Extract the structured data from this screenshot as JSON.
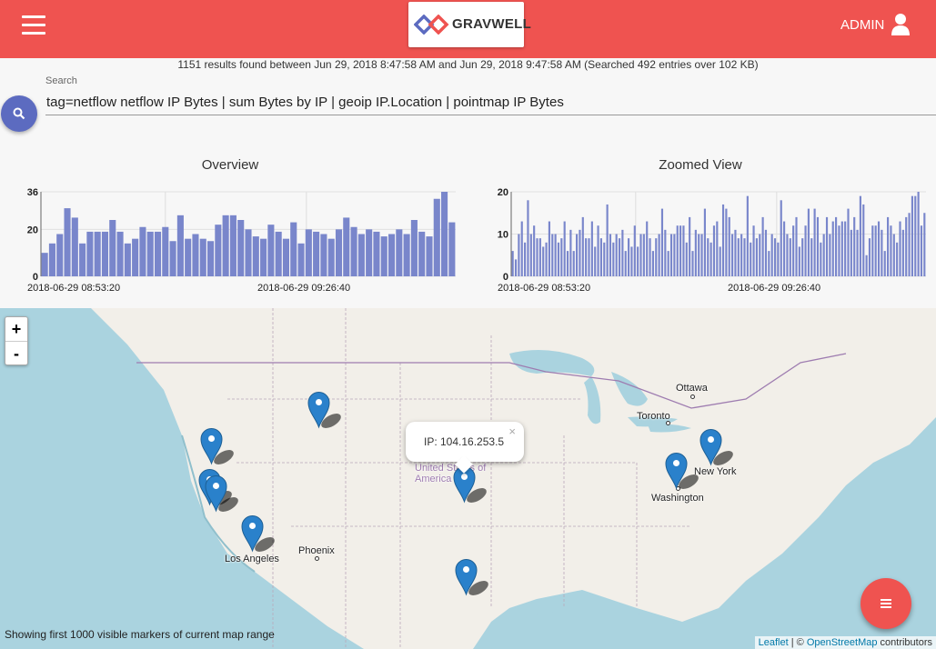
{
  "header": {
    "menu_icon": "hamburger-menu-icon",
    "logo_text": "GRAVWELL",
    "user_label": "ADMIN",
    "user_icon": "user-icon",
    "bar_color": "#ef5350"
  },
  "status": {
    "summary": "1151 results found between Jun 29, 2018 8:47:58 AM and Jun 29, 2018 9:47:58 AM (Searched 492 entries over 102 KB)"
  },
  "search": {
    "label": "Search",
    "query": "tag=netflow netflow IP Bytes | sum Bytes by IP | geoip IP.Location | pointmap IP Bytes",
    "button_icon": "search-icon"
  },
  "chart_data": [
    {
      "type": "bar",
      "title": "Overview",
      "ylim": [
        0,
        36
      ],
      "yticks": [
        "36",
        "20",
        "0"
      ],
      "ytick_values": [
        36,
        20,
        0
      ],
      "x_tick_labels": [
        "2018-06-29 08:53:20",
        "2018-06-29 09:26:40"
      ],
      "color": "#7986cb",
      "values": [
        10,
        14,
        18,
        29,
        25,
        14,
        19,
        19,
        19,
        24,
        19,
        14,
        16,
        21,
        19,
        19,
        21,
        15,
        26,
        16,
        18,
        16,
        15,
        22,
        26,
        26,
        24,
        20,
        17,
        16,
        22,
        19,
        16,
        23,
        14,
        20,
        19,
        18,
        16,
        20,
        25,
        21,
        18,
        20,
        19,
        17,
        18,
        20,
        18,
        24,
        19,
        17,
        33,
        36,
        23
      ]
    },
    {
      "type": "bar",
      "title": "Zoomed View",
      "ylim": [
        0,
        20
      ],
      "yticks": [
        "20",
        "10",
        "0"
      ],
      "ytick_values": [
        20,
        10,
        0
      ],
      "x_tick_labels": [
        "2018-06-29 08:53:20",
        "2018-06-29 09:26:40"
      ],
      "color": "#7986cb",
      "values": [
        6,
        4,
        10,
        13,
        8,
        18,
        10,
        12,
        9,
        9,
        7,
        8,
        13,
        10,
        10,
        8,
        9,
        13,
        6,
        11,
        6,
        10,
        11,
        14,
        9,
        9,
        13,
        7,
        12,
        9,
        8,
        17,
        10,
        8,
        10,
        9,
        11,
        6,
        9,
        7,
        12,
        7,
        10,
        10,
        13,
        9,
        6,
        9,
        10,
        16,
        11,
        6,
        10,
        10,
        12,
        12,
        12,
        8,
        14,
        6,
        11,
        10,
        10,
        16,
        9,
        8,
        12,
        13,
        7,
        17,
        16,
        14,
        10,
        11,
        9,
        10,
        9,
        19,
        8,
        12,
        9,
        10,
        14,
        11,
        6,
        10,
        9,
        8,
        18,
        13,
        10,
        9,
        12,
        14,
        7,
        9,
        12,
        16,
        9,
        16,
        14,
        8,
        10,
        14,
        10,
        13,
        14,
        12,
        13,
        13,
        16,
        11,
        14,
        11,
        19,
        17,
        5,
        9,
        12,
        12,
        13,
        11,
        6,
        14,
        12,
        10,
        8,
        13,
        11,
        14,
        15,
        19,
        19,
        20,
        12,
        15
      ]
    }
  ],
  "map": {
    "zoom_in": "+",
    "zoom_out": "-",
    "popup_text": "IP: 104.16.253.5",
    "popup_close": "×",
    "note": "Showing first 1000 visible markers of current map range",
    "fab_icon": "list-menu-icon",
    "attribution": {
      "leaflet": "Leaflet",
      "sep": " | © ",
      "osm": "OpenStreetMap",
      "tail": " contributors"
    },
    "cities": [
      {
        "name": "Ottawa"
      },
      {
        "name": "Toronto"
      },
      {
        "name": "New York"
      },
      {
        "name": "Washington"
      },
      {
        "name": "Phoenix"
      },
      {
        "name": "Los Angeles"
      },
      {
        "name": "United States of America"
      }
    ],
    "marker_color": "#2a81cb",
    "water_color": "#aad3df",
    "land_color": "#f2efe9"
  }
}
